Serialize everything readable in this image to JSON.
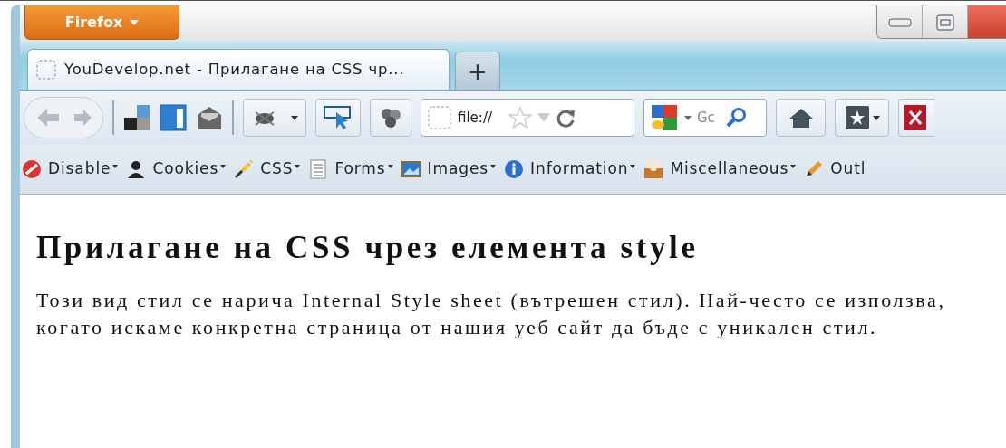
{
  "app_button": {
    "label": "Firefox"
  },
  "tabs": [
    {
      "title": "YouDevelop.net - Прилагане на CSS чр...",
      "selected": true
    }
  ],
  "new_tab": {
    "label": "+"
  },
  "url_bar": {
    "value": "file://"
  },
  "search_bar": {
    "placeholder": "Gc"
  },
  "addon_toolbar": [
    {
      "kind": "disable",
      "label": "Disable",
      "has_menu": true
    },
    {
      "kind": "cookies",
      "label": "Cookies",
      "has_menu": true
    },
    {
      "kind": "css",
      "label": "CSS",
      "has_menu": true
    },
    {
      "kind": "forms",
      "label": "Forms",
      "has_menu": true
    },
    {
      "kind": "images",
      "label": "Images",
      "has_menu": true
    },
    {
      "kind": "information",
      "label": "Information",
      "has_menu": true
    },
    {
      "kind": "miscellaneous",
      "label": "Miscellaneous",
      "has_menu": true
    },
    {
      "kind": "outline",
      "label": "Outl",
      "has_menu": false
    }
  ],
  "page": {
    "heading": "Прилагане на CSS чрез елемента style",
    "paragraph": "Този вид стил се нарича Internal Style sheet (вътрешен стил). Най-често се използва, когато искаме конкретна страница от нашия уеб сайт да бъде с уникален стил."
  }
}
